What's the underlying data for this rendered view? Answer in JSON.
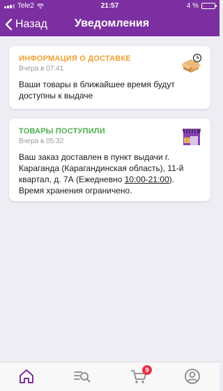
{
  "status": {
    "carrier": "Tele2",
    "time": "21:57",
    "battery": "4 %",
    "battery_level": 0.04
  },
  "nav": {
    "back_label": "Назад",
    "title": "Уведомления"
  },
  "notifications": [
    {
      "title": "ИНФОРМАЦИЯ О ДОСТАВКЕ",
      "title_color": "#f0a030",
      "date": "Вчера в 07:41",
      "body": "Ваши товары в ближайшее время будут доступны к выдаче",
      "icon": "delivery-box-clock-icon"
    },
    {
      "title": "ТОВАРЫ ПОСТУПИЛИ",
      "title_color": "#4caf50",
      "date": "Вчера в 05:32",
      "body_before": "Ваш заказ доставлен в пункт выдачи г. Караганда (Карагандинская область), 11-й квартал, д. 7А (Ежедневно ",
      "body_hours": "10:00-21:00",
      "body_after": "). Время хранения ограничено.",
      "icon": "pickup-store-icon"
    }
  ],
  "tabbar": {
    "items": [
      "home-icon",
      "search-list-icon",
      "cart-icon",
      "profile-icon"
    ],
    "active_color": "#7b2fa0",
    "inactive_color": "#8a8a8a",
    "cart_badge": "9"
  },
  "colors": {
    "header_bg": "#7b2fa0",
    "page_bg": "#efedf4",
    "badge_bg": "#e8334a"
  }
}
